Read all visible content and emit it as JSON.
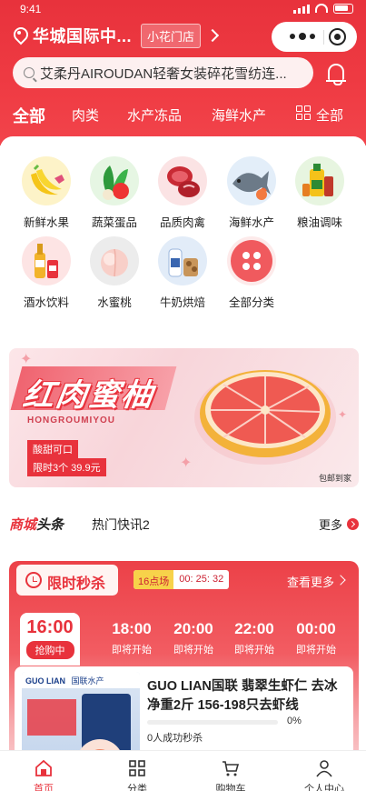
{
  "status_bar": {
    "time": "9:41"
  },
  "header": {
    "location": "华城国际中...",
    "store": "小花门店",
    "search_placeholder": "艾柔丹AIROUDAN轻奢女装碎花雪纺连..."
  },
  "category_tabs": [
    "全部",
    "肉类",
    "水产冻品",
    "海鲜水产",
    "全部"
  ],
  "categories": [
    {
      "label": "新鲜水果",
      "icon": "banana-icon"
    },
    {
      "label": "蔬菜蛋品",
      "icon": "vegetable-icon"
    },
    {
      "label": "品质肉禽",
      "icon": "meat-icon"
    },
    {
      "label": "海鲜水产",
      "icon": "seafood-icon"
    },
    {
      "label": "粮油调味",
      "icon": "oil-icon"
    },
    {
      "label": "酒水饮料",
      "icon": "drink-icon"
    },
    {
      "label": "水蜜桃",
      "icon": "peach-icon"
    },
    {
      "label": "牛奶烘焙",
      "icon": "milk-icon"
    },
    {
      "label": "全部分类",
      "icon": "all-categories-icon"
    }
  ],
  "banner": {
    "title": "红肉蜜柚",
    "pinyin": "HONGROUMIYOU",
    "tag1": "酸甜可口",
    "tag2": "限时3个 39.9元",
    "note": "包邮到家"
  },
  "news": {
    "logo_a": "商城",
    "logo_b": "头条",
    "text": "热门快讯2",
    "more": "更多"
  },
  "flash_sale": {
    "title": "限时秒杀",
    "session": "16点场",
    "countdown": "00: 25: 32",
    "more": "查看更多",
    "slots": [
      {
        "time": "16:00",
        "status": "抢购中"
      },
      {
        "time": "18:00",
        "status": "即将开始"
      },
      {
        "time": "20:00",
        "status": "即将开始"
      },
      {
        "time": "22:00",
        "status": "即将开始"
      },
      {
        "time": "00:00",
        "status": "即将开始"
      }
    ],
    "product": {
      "name": "GUO LIAN国联 翡翠生虾仁 去冰净重2斤 156-198只去虾线",
      "progress": "0%",
      "progress_value": 0,
      "sold": "0人成功秒杀",
      "img_brand": "GUO LIAN",
      "img_tag": "国联水产"
    }
  },
  "tabbar": [
    {
      "label": "首页",
      "icon": "home-icon"
    },
    {
      "label": "分类",
      "icon": "category-icon"
    },
    {
      "label": "购物车",
      "icon": "cart-icon"
    },
    {
      "label": "个人中心",
      "icon": "user-icon"
    }
  ],
  "colors": {
    "primary": "#e8323c",
    "accent_yellow": "#f7d24a"
  }
}
